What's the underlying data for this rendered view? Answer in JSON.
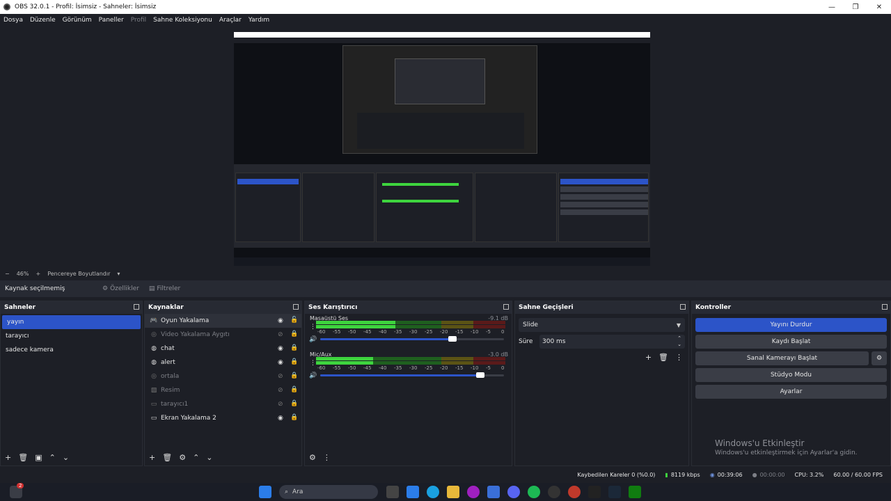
{
  "window": {
    "title": "OBS 32.0.1 - Profil: İsimsiz - Sahneler: İsimsiz",
    "minimize": "—",
    "maximize": "❐",
    "close": "✕"
  },
  "menu": [
    "Dosya",
    "Düzenle",
    "Görünüm",
    "Paneller",
    "Profil",
    "Sahne Koleksiyonu",
    "Araçlar",
    "Yardım"
  ],
  "zoom": {
    "minus": "−",
    "level": "46%",
    "plus": "+",
    "mode": "Pencereye Boyutlandır",
    "dropdown": "▾"
  },
  "source_toolbar": {
    "no_selection": "Kaynak seçilmemiş",
    "properties": "Özellikler",
    "filters": "Filtreler"
  },
  "scenes": {
    "title": "Sahneler",
    "items": [
      "yayın",
      "tarayıcı",
      "sadece kamera"
    ],
    "selected": 0
  },
  "sources": {
    "title": "Kaynaklar",
    "items": [
      {
        "label": "Oyun Yakalama",
        "icon": "gamepad-icon",
        "visible": true,
        "locked": false,
        "dim": false
      },
      {
        "label": "Video Yakalama Aygıtı",
        "icon": "camera-icon",
        "visible": false,
        "locked": true,
        "dim": true
      },
      {
        "label": "chat",
        "icon": "globe-icon",
        "visible": true,
        "locked": true,
        "dim": false
      },
      {
        "label": "alert",
        "icon": "globe-icon",
        "visible": true,
        "locked": true,
        "dim": false
      },
      {
        "label": "ortala",
        "icon": "camera-icon",
        "visible": false,
        "locked": true,
        "dim": true
      },
      {
        "label": "Resim",
        "icon": "image-icon",
        "visible": false,
        "locked": true,
        "dim": true
      },
      {
        "label": "tarayıcı1",
        "icon": "window-icon",
        "visible": false,
        "locked": true,
        "dim": true
      },
      {
        "label": "Ekran Yakalama 2",
        "icon": "monitor-icon",
        "visible": true,
        "locked": true,
        "dim": false
      }
    ]
  },
  "mixer": {
    "title": "Ses Karıştırıcı",
    "ticks": [
      "-60",
      "-55",
      "-50",
      "-45",
      "-40",
      "-35",
      "-30",
      "-25",
      "-20",
      "-15",
      "-10",
      "-5",
      "0"
    ],
    "channels": [
      {
        "name": "Masaüstü Ses",
        "db": "-9.1 dB",
        "level": 0.42,
        "volume": 0.72
      },
      {
        "name": "Mic/Aux",
        "db": "-3.0 dB",
        "level": 0.3,
        "volume": 0.87
      }
    ]
  },
  "transitions": {
    "title": "Sahne Geçişleri",
    "selected": "Slide",
    "duration_label": "Süre",
    "duration": "300 ms"
  },
  "controls": {
    "title": "Kontroller",
    "buttons": [
      "Yayını Durdur",
      "Kaydı Başlat",
      "Sanal Kamerayı Başlat",
      "Stüdyo Modu",
      "Ayarlar"
    ]
  },
  "activation": {
    "title": "Windows'u Etkinleştir",
    "subtitle": "Windows'u etkinleştirmek için Ayarlar'a gidin."
  },
  "status": {
    "dropped": "Kaybedilen Kareler 0 (%0.0)",
    "bitrate": "8119 kbps",
    "stream_time": "00:39:06",
    "rec_time": "00:00:00",
    "cpu": "CPU: 3.2%",
    "fps": "60.00 / 60.00 FPS"
  },
  "taskbar": {
    "search_placeholder": "Ara",
    "notification_count": "2"
  },
  "colors": {
    "accent": "#2c54c8",
    "meter_green": "#3ed43e",
    "meter_yellow": "#c8b400",
    "meter_red": "#d03030"
  }
}
